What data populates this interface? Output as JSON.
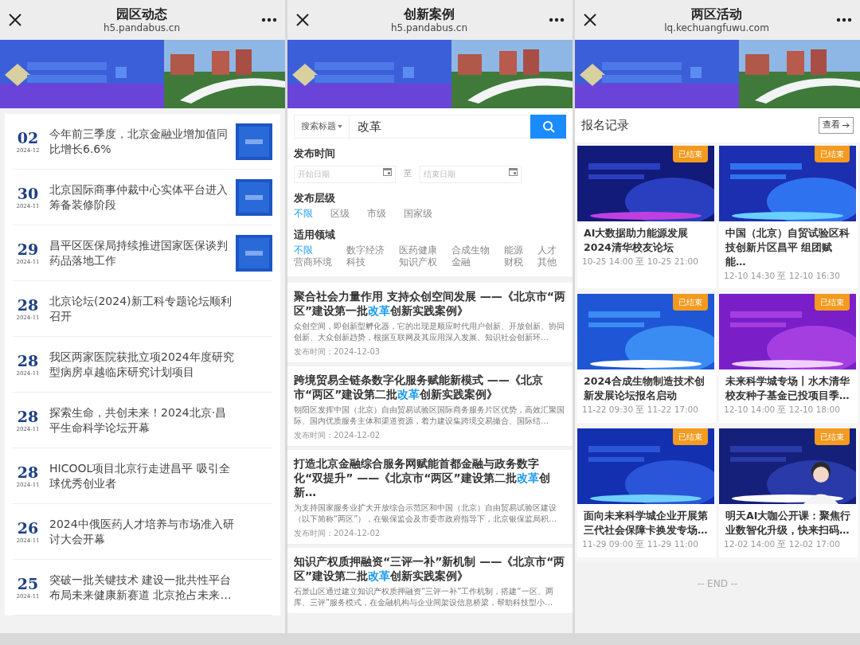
{
  "panels": [
    {
      "kind": "news",
      "header": {
        "title": "园区动态",
        "url": "h5.pandabus.cn"
      },
      "items": [
        {
          "day": "02",
          "month": "2024-12",
          "title": "今年前三季度，北京金融业增加值同比增长6.6%",
          "has_picture": true
        },
        {
          "day": "30",
          "month": "2024-11",
          "title": "北京国际商事仲裁中心实体平台进入筹备装修阶段",
          "has_picture": true
        },
        {
          "day": "29",
          "month": "2024-11",
          "title": "昌平区医保局持续推进国家医保谈判药品落地工作",
          "has_picture": true
        },
        {
          "day": "28",
          "month": "2024-11",
          "title": "北京论坛(2024)新工科专题论坛顺利召开",
          "has_picture": false
        },
        {
          "day": "28",
          "month": "2024-11",
          "title": "我区两家医院获批立项2024年度研究型病房卓越临床研究计划项目",
          "has_picture": false
        },
        {
          "day": "28",
          "month": "2024-11",
          "title": "探索生命，共创未来！2024北京·昌平生命科学论坛开幕",
          "has_picture": false
        },
        {
          "day": "28",
          "month": "2024-11",
          "title": "HICOOL项目北京行走进昌平 吸引全球优秀创业者",
          "has_picture": false
        },
        {
          "day": "26",
          "month": "2024-11",
          "title": "2024中俄医药人才培养与市场准入研讨大会开幕",
          "has_picture": false
        },
        {
          "day": "25",
          "month": "2024-11",
          "title": "突破一批关键技术 建设一批共性平台布局未来健康新赛道 北京抢占未来…",
          "has_picture": false
        }
      ]
    },
    {
      "kind": "cases",
      "header": {
        "title": "创新案例",
        "url": "h5.pandabus.cn"
      },
      "search": {
        "scope": "搜索标题",
        "value": "改革"
      },
      "date_filter": {
        "label": "发布时间",
        "start_placeholder": "开始日期",
        "separator": "至",
        "end_placeholder": "结束日期"
      },
      "filter_groups": [
        {
          "label": "发布层级",
          "options": [
            {
              "label": "不限",
              "selected": true
            },
            {
              "label": "区级",
              "selected": false
            },
            {
              "label": "市级",
              "selected": false
            },
            {
              "label": "国家级",
              "selected": false
            }
          ]
        },
        {
          "label": "适用领域",
          "options": [
            {
              "label": "不限",
              "selected": true
            },
            {
              "label": "数字经济",
              "selected": false
            },
            {
              "label": "医药健康",
              "selected": false
            },
            {
              "label": "合成生物",
              "selected": false
            },
            {
              "label": "能源",
              "selected": false
            },
            {
              "label": "人才",
              "selected": false
            },
            {
              "label": "营商环境",
              "selected": false
            },
            {
              "label": "科技",
              "selected": false
            },
            {
              "label": "知识产权",
              "selected": false
            },
            {
              "label": "金融",
              "selected": false
            },
            {
              "label": "财税",
              "selected": false
            },
            {
              "label": "其他",
              "selected": false
            }
          ]
        }
      ],
      "articles": [
        {
          "title": [
            {
              "text": "聚合社会力量作用 支持众创空间发展 ——《北京市“两区”建设第一批",
              "highlight": false
            },
            {
              "text": "改革",
              "highlight": true
            },
            {
              "text": "创新实践案例》",
              "highlight": false
            }
          ],
          "summary": "众创空间，即创新型孵化器，它的出现是顺应时代用户创新、开放创新、协同创新、大众创新趋势，根据互联网及其应用深入发展、知识社会创新环…",
          "date": "发布时间：2024-12-03"
        },
        {
          "title": [
            {
              "text": "跨境贸易全链条数字化服务赋能新模式 ——《北京市“两区”建设第二批",
              "highlight": false
            },
            {
              "text": "改革",
              "highlight": true
            },
            {
              "text": "创新实践案例》",
              "highlight": false
            }
          ],
          "summary": "朝阳区发挥中国（北京）自由贸易试验区国际商务服务片区优势，高效汇聚国际、国内优质服务主体和渠道资源，着力建设集跨境交易撮合、国际结…",
          "date": "发布时间：2024-12-02"
        },
        {
          "title": [
            {
              "text": "打造北京金融综合服务网赋能首都金融与政务数字化“双提升” ——《北京市“两区”建设第二批",
              "highlight": false
            },
            {
              "text": "改革",
              "highlight": true
            },
            {
              "text": "创新…",
              "highlight": false
            }
          ],
          "summary": "为支持国家服务业扩大开放综合示范区和中国（北京）自由贸易试验区建设（以下简称“两区”），在银保监会及市委市政府指导下，北京银保监局积…",
          "date": "发布时间：2024-12-02"
        },
        {
          "title": [
            {
              "text": "知识产权质押融资“三评一补”新机制 ——《北京市“两区”建设第二批",
              "highlight": false
            },
            {
              "text": "改革",
              "highlight": true
            },
            {
              "text": "创新实践案例》",
              "highlight": false
            }
          ],
          "summary": "石景山区通过建立知识产权质押融资“三评一补”工作机制，搭建“一区、两库、三评”服务模式，在金融机构与企业间架设信息桥梁，帮助科技型小…"
        }
      ]
    },
    {
      "kind": "events",
      "header": {
        "title": "两区活动",
        "url": "lq.kechuangfuwu.com"
      },
      "section_title": "报名记录",
      "view_button": "查看",
      "events": [
        {
          "title": "AI大数据助力能源发展 2024清华校友论坛",
          "time": "10-25 14:00 至 10-25 21:00",
          "status": "已结束"
        },
        {
          "title": "中国（北京）自贸试验区科技创新片区昌平 组团赋能…",
          "time": "12-10 14:30 至 12-10 16:30",
          "status": "已结束"
        },
        {
          "title": "2024合成生物制造技术创新发展论坛报名启动",
          "time": "11-22 09:30 至 11-22 17:00",
          "status": "已结束"
        },
        {
          "title": "未来科学城专场丨水木清华校友种子基金已投项目季…",
          "time": "12-10 14:00 至 12-10 18:00",
          "status": "已结束"
        },
        {
          "title": "面向未来科学城企业开展第三代社会保障卡换发专场…",
          "time": "11-29 09:00 至 11-29 11:00",
          "status": "已结束"
        },
        {
          "title": "明天AI大咖公开课：聚焦行业数智化升级，快来扫码…",
          "time": "12-02 14:00 至 12-02 17:00",
          "status": "已结束"
        }
      ],
      "footer": "-- END --"
    }
  ]
}
